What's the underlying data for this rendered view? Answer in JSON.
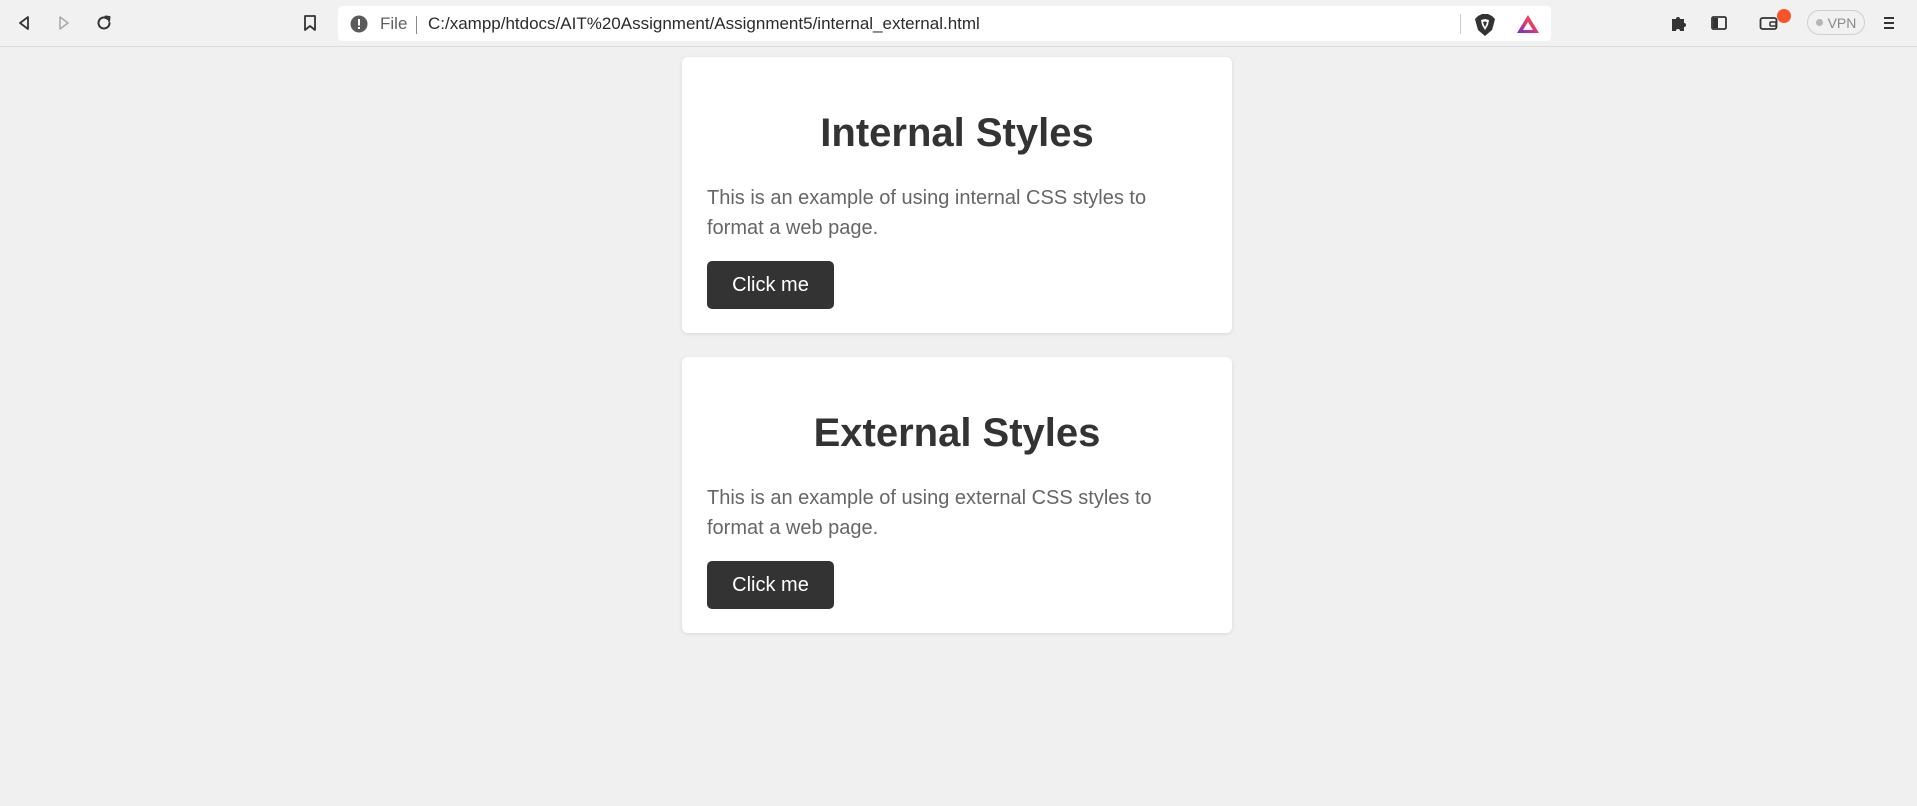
{
  "browser": {
    "url_scheme": "File",
    "url": "C:/xampp/htdocs/AIT%20Assignment/Assignment5/internal_external.html",
    "vpn_label": "VPN",
    "icons": {
      "back": "back-arrow-icon",
      "forward": "forward-arrow-icon",
      "reload": "reload-icon",
      "bookmark": "bookmark-icon",
      "info": "info-icon",
      "shields": "brave-shields-icon",
      "rewards": "brave-rewards-icon",
      "extensions": "puzzle-icon",
      "sidebar": "sidebar-icon",
      "wallet": "wallet-icon",
      "menu": "menu-icon"
    },
    "colors": {
      "badge": "#fb542b",
      "toolbar_bg": "#f1f1f1"
    }
  },
  "page": {
    "background": "#f0f0f0",
    "sections": [
      {
        "heading": "Internal Styles",
        "text": "This is an example of using internal CSS styles to format a web page.",
        "button_label": "Click me"
      },
      {
        "heading": "External Styles",
        "text": "This is an example of using external CSS styles to format a web page.",
        "button_label": "Click me"
      }
    ],
    "colors": {
      "heading": "#333333",
      "text": "#666666",
      "button_bg": "#333333",
      "button_text": "#ffffff"
    }
  }
}
